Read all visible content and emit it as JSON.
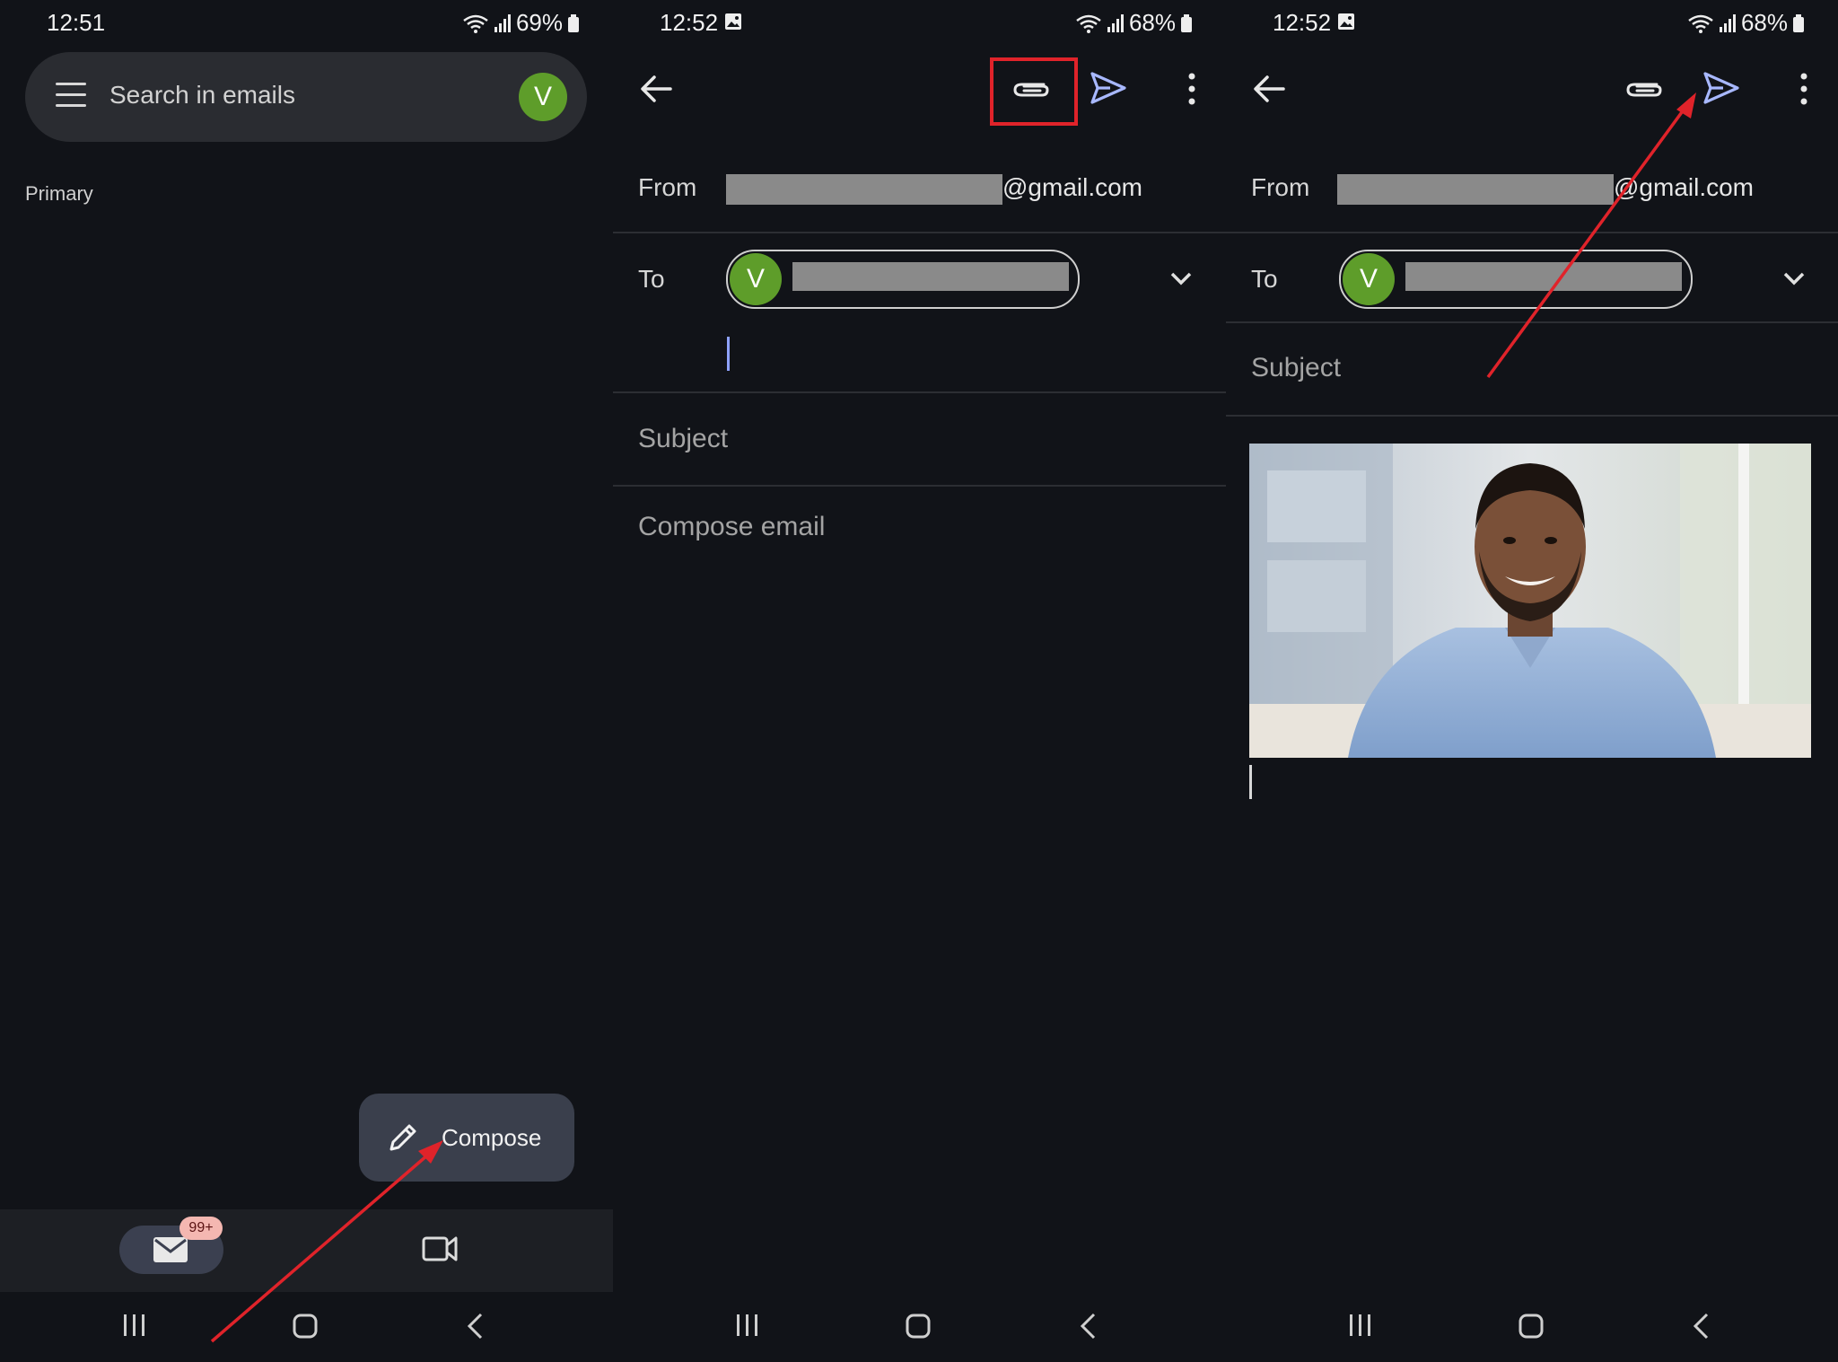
{
  "panel1": {
    "status": {
      "time": "12:51",
      "battery": "69%"
    },
    "search": {
      "placeholder": "Search in emails",
      "avatar_letter": "V"
    },
    "section_label": "Primary",
    "compose_button": {
      "label": "Compose"
    },
    "bottom_nav": {
      "mail_badge": "99+"
    }
  },
  "panel2": {
    "status": {
      "time": "12:52",
      "battery": "68%"
    },
    "from_label": "From",
    "from_suffix": "@gmail.com",
    "to_label": "To",
    "to_avatar_letter": "V",
    "subject_placeholder": "Subject",
    "body_placeholder": "Compose email"
  },
  "panel3": {
    "status": {
      "time": "12:52",
      "battery": "68%"
    },
    "from_label": "From",
    "from_suffix": "@gmail.com",
    "to_label": "To",
    "to_avatar_letter": "V",
    "subject_placeholder": "Subject"
  },
  "colors": {
    "background": "#111318",
    "accent_send": "#a8b8ff",
    "annotation_red": "#e0232a",
    "avatar_green": "#5e9d2a"
  }
}
